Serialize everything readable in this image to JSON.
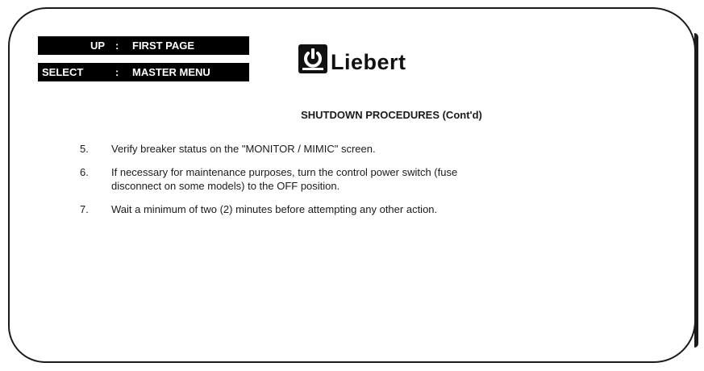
{
  "keys": {
    "up": {
      "name": "UP",
      "colon": ":",
      "action": "FIRST PAGE"
    },
    "select": {
      "name": "SELECT",
      "colon": ":",
      "action": "MASTER MENU"
    }
  },
  "logo": {
    "icon": "power-icon",
    "text": "Liebert"
  },
  "heading": "SHUTDOWN PROCEDURES (Cont'd)",
  "steps": [
    {
      "num": "5.",
      "text": "Verify breaker status on the \"MONITOR / MIMIC\" screen."
    },
    {
      "num": "6.",
      "line1": "If necessary for maintenance purposes, turn the control power switch (fuse",
      "line2": "disconnect on some models) to the OFF position."
    },
    {
      "num": "7.",
      "text": "Wait a minimum of two (2) minutes before attempting any other action."
    }
  ],
  "colors": {
    "frame": "#1a1a1a",
    "key_background": "#000000",
    "key_text": "#ffffff"
  }
}
